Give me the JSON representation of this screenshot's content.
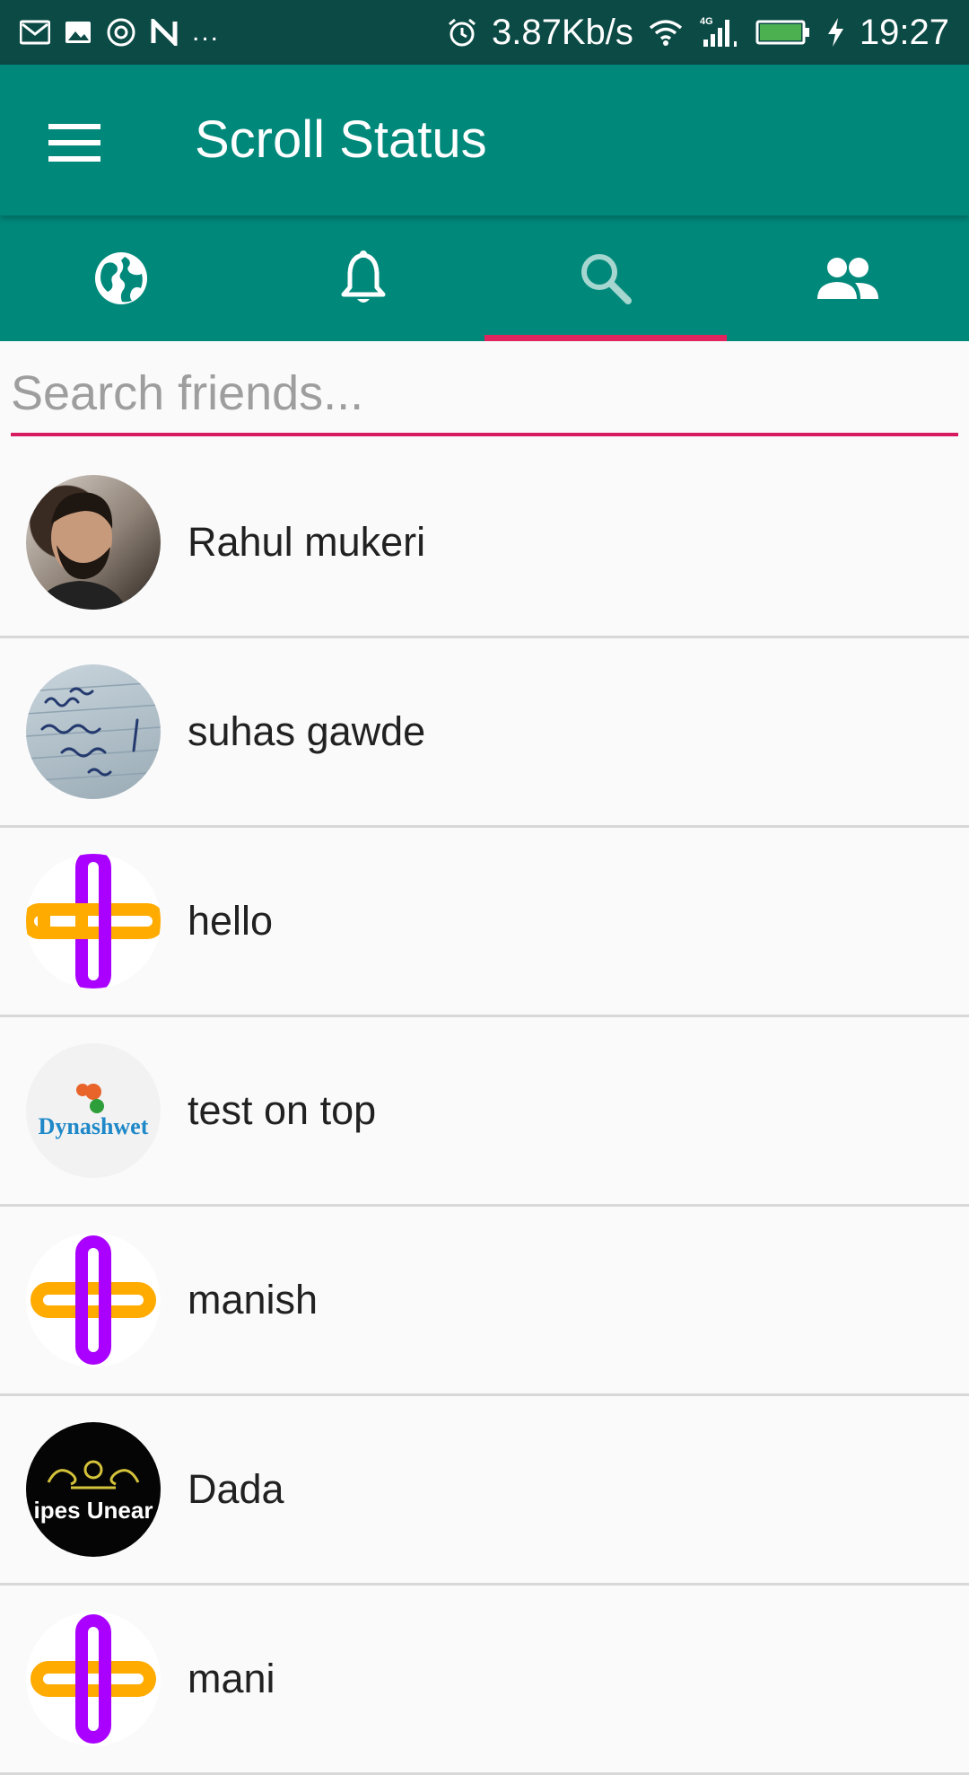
{
  "status_bar": {
    "network_speed": "3.87Kb/s",
    "network_type": "4G",
    "time": "19:27",
    "overflow": "...",
    "icons": [
      "gmail-icon",
      "gallery-icon",
      "vpn-icon",
      "n-app-icon",
      "alarm-icon",
      "wifi-icon",
      "signal-icon",
      "battery-icon",
      "charging-icon"
    ]
  },
  "app_bar": {
    "title": "Scroll Status",
    "menu_icon": "menu-icon",
    "background": "#00897b"
  },
  "tabs": [
    {
      "icon": "globe-icon",
      "active": false
    },
    {
      "icon": "bell-icon",
      "active": false
    },
    {
      "icon": "search-icon",
      "active": true
    },
    {
      "icon": "people-icon",
      "active": false
    }
  ],
  "search": {
    "placeholder": "Search friends...",
    "value": "",
    "accent": "#d81b60"
  },
  "friends": [
    {
      "name": "Rahul mukeri",
      "avatar": "photo"
    },
    {
      "name": "suhas gawde",
      "avatar": "handwritten-note"
    },
    {
      "name": "hello",
      "avatar": "app-logo"
    },
    {
      "name": "test on top",
      "avatar": "dynashwet-logo",
      "avatar_text": "Dynashwet"
    },
    {
      "name": "manish",
      "avatar": "app-logo"
    },
    {
      "name": "Dada",
      "avatar": "black-emblem",
      "avatar_text": "ipes Unear"
    },
    {
      "name": "mani",
      "avatar": "app-logo"
    }
  ]
}
